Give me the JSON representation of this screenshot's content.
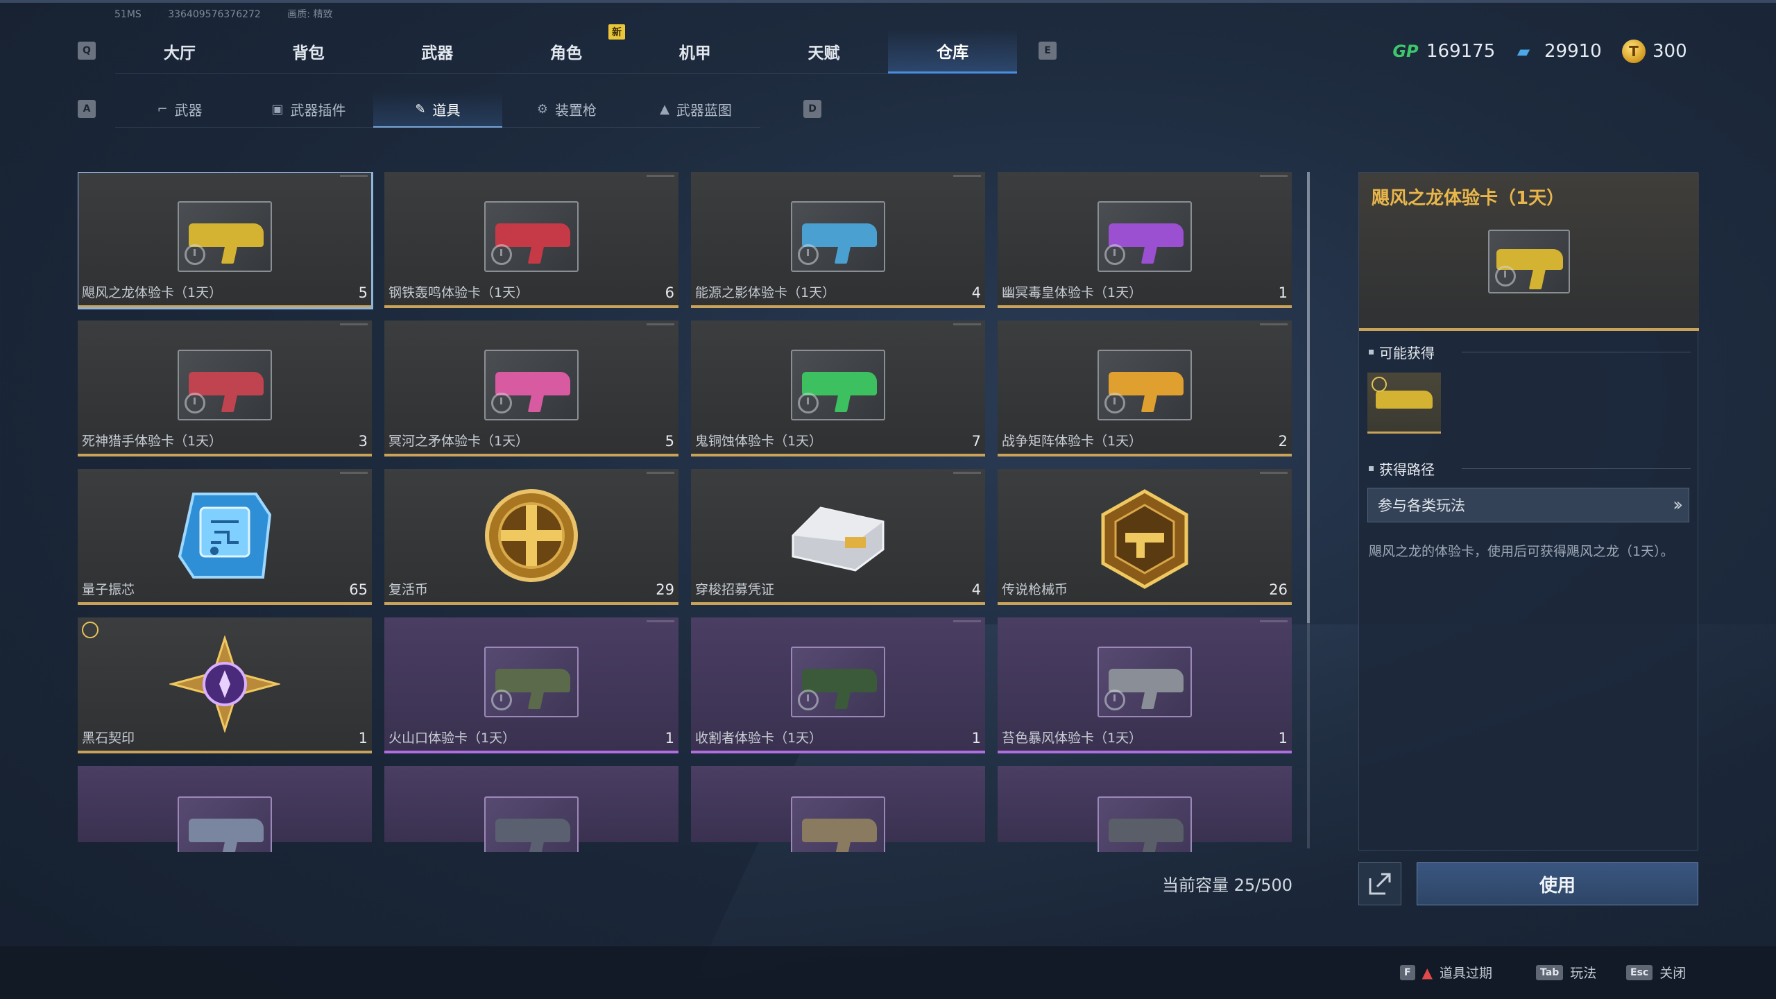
{
  "debug": {
    "fps": "51MS",
    "uid": "336409576376272",
    "quality": "画质: 精致"
  },
  "keys": {
    "prev_tab": "Q",
    "next_tab": "E",
    "prev_sub": "A",
    "next_sub": "D"
  },
  "nav": {
    "tabs": [
      "大厅",
      "背包",
      "武器",
      "角色",
      "机甲",
      "天赋",
      "仓库"
    ],
    "active": "仓库",
    "new_badge": "新"
  },
  "subnav": {
    "tabs": [
      {
        "label": "武器",
        "icon": "gun-icon"
      },
      {
        "label": "武器插件",
        "icon": "chip-icon"
      },
      {
        "label": "道具",
        "icon": "tag-icon"
      },
      {
        "label": "装置枪",
        "icon": "turret-icon"
      },
      {
        "label": "武器蓝图",
        "icon": "blueprint-icon"
      }
    ],
    "active": "道具"
  },
  "currency": {
    "gp": "169175",
    "tickets": "29910",
    "coins": "300"
  },
  "items": [
    {
      "name": "飓风之龙体验卡（1天）",
      "qty": "5",
      "rarity": "gold",
      "accent": "#d4b232"
    },
    {
      "name": "钢铁轰鸣体验卡（1天）",
      "qty": "6",
      "rarity": "gold",
      "accent": "#c63a48"
    },
    {
      "name": "能源之影体验卡（1天）",
      "qty": "4",
      "rarity": "gold",
      "accent": "#4aa0d0"
    },
    {
      "name": "幽冥毒皇体验卡（1天）",
      "qty": "1",
      "rarity": "gold",
      "accent": "#9a50d0"
    },
    {
      "name": "死神猎手体验卡（1天）",
      "qty": "3",
      "rarity": "gold",
      "accent": "#c04450"
    },
    {
      "name": "冥河之矛体验卡（1天）",
      "qty": "5",
      "rarity": "gold",
      "accent": "#d85aa0"
    },
    {
      "name": "鬼铜蚀体验卡（1天）",
      "qty": "7",
      "rarity": "gold",
      "accent": "#3cc060"
    },
    {
      "name": "战争矩阵体验卡（1天）",
      "qty": "2",
      "rarity": "gold",
      "accent": "#e0a030"
    },
    {
      "name": "量子振芯",
      "qty": "65",
      "rarity": "gold",
      "icon": "quantum-chip-icon"
    },
    {
      "name": "复活币",
      "qty": "29",
      "rarity": "gold",
      "icon": "revive-coin-icon"
    },
    {
      "name": "穿梭招募凭证",
      "qty": "4",
      "rarity": "gold",
      "icon": "voucher-icon"
    },
    {
      "name": "传说枪械币",
      "qty": "26",
      "rarity": "gold",
      "icon": "legend-gun-coin-icon"
    },
    {
      "name": "黑石契印",
      "qty": "1",
      "rarity": "gold",
      "icon": "blackstone-seal-icon",
      "timed": true
    },
    {
      "name": "火山口体验卡（1天）",
      "qty": "1",
      "rarity": "purple",
      "accent": "#5a6a4a"
    },
    {
      "name": "收割者体验卡（1天）",
      "qty": "1",
      "rarity": "purple",
      "accent": "#3a5a3a"
    },
    {
      "name": "苔色暴风体验卡（1天）",
      "qty": "1",
      "rarity": "purple",
      "accent": "#8a8e96"
    }
  ],
  "capacity": "当前容量 25/500",
  "detail": {
    "title": "飓风之龙体验卡（1天）",
    "may_obtain": "可能获得",
    "obtain_route_title": "获得路径",
    "route": "参与各类玩法",
    "description": "飓风之龙的体验卡，使用后可获得飓风之龙（1天）。",
    "use_label": "使用"
  },
  "footer": {
    "hints": [
      {
        "key": "F",
        "label": "道具过期"
      },
      {
        "key": "Tab",
        "label": "玩法"
      },
      {
        "key": "Esc",
        "label": "关闭"
      }
    ]
  },
  "colors": {
    "gold_edge": "#c9a35a",
    "purple_edge": "#b06fe0",
    "title_gold": "#e8b64a",
    "accent_blue": "#4a8ee0"
  }
}
